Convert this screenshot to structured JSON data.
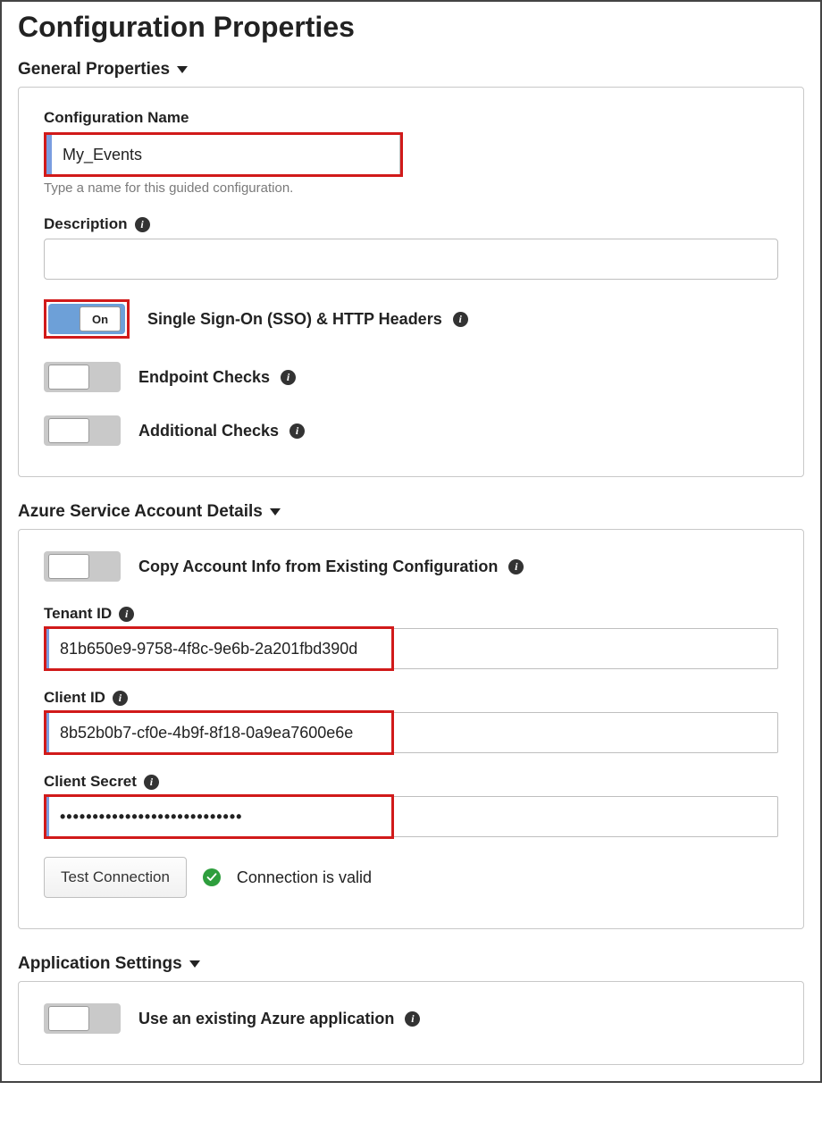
{
  "page_title": "Configuration Properties",
  "sections": {
    "general": {
      "header": "General Properties",
      "config_name_label": "Configuration Name",
      "config_name_value": "My_Events",
      "config_name_hint": "Type a name for this guided configuration.",
      "description_label": "Description",
      "description_value": "",
      "sso_toggle_text": "On",
      "sso_label": "Single Sign-On (SSO) & HTTP Headers",
      "endpoint_label": "Endpoint Checks",
      "additional_label": "Additional Checks"
    },
    "azure": {
      "header": "Azure Service Account Details",
      "copy_label": "Copy Account Info from Existing Configuration",
      "tenant_label": "Tenant ID",
      "tenant_value": "81b650e9-9758-4f8c-9e6b-2a201fbd390d",
      "client_label": "Client ID",
      "client_value": "8b52b0b7-cf0e-4b9f-8f18-0a9ea7600e6e",
      "secret_label": "Client Secret",
      "secret_display": "••••••••••••••••••••••••••••",
      "test_button": "Test Connection",
      "test_status": "Connection is valid"
    },
    "appsettings": {
      "header": "Application Settings",
      "use_existing_label": "Use an existing Azure application"
    }
  }
}
